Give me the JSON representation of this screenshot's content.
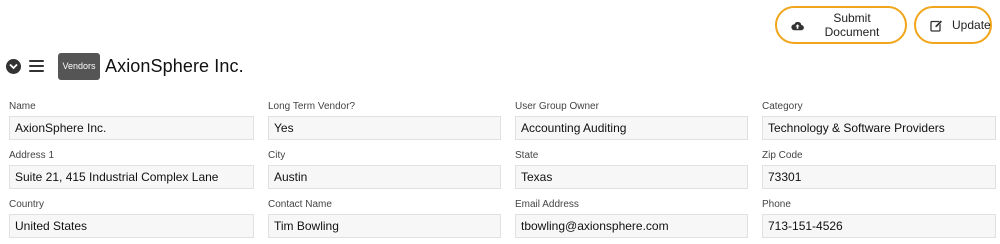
{
  "actions": {
    "submit_label": "Submit Document",
    "update_label": "Update"
  },
  "header": {
    "badge": "Vendors",
    "title": "AxionSphere Inc."
  },
  "fields": [
    [
      {
        "label": "Name",
        "value": "AxionSphere Inc."
      },
      {
        "label": "Long Term Vendor?",
        "value": "Yes"
      },
      {
        "label": "User Group Owner",
        "value": "Accounting Auditing"
      },
      {
        "label": "Category",
        "value": "Technology & Software Providers"
      }
    ],
    [
      {
        "label": "Address 1",
        "value": "Suite 21, 415 Industrial Complex Lane"
      },
      {
        "label": "City",
        "value": "Austin"
      },
      {
        "label": "State",
        "value": "Texas"
      },
      {
        "label": "Zip Code",
        "value": "73301"
      }
    ],
    [
      {
        "label": "Country",
        "value": "United States"
      },
      {
        "label": "Contact Name",
        "value": "Tim Bowling"
      },
      {
        "label": "Email Address",
        "value": "tbowling@axionsphere.com"
      },
      {
        "label": "Phone",
        "value": "713-151-4526"
      }
    ]
  ],
  "colors": {
    "button_border": "#f0a51b",
    "badge_bg": "#555555",
    "field_bg": "#f7f7f7"
  },
  "icons": {
    "submit": "cloud-upload-icon",
    "update": "edit-icon",
    "collapse": "chevron-down-icon",
    "menu": "hamburger-menu-icon"
  }
}
